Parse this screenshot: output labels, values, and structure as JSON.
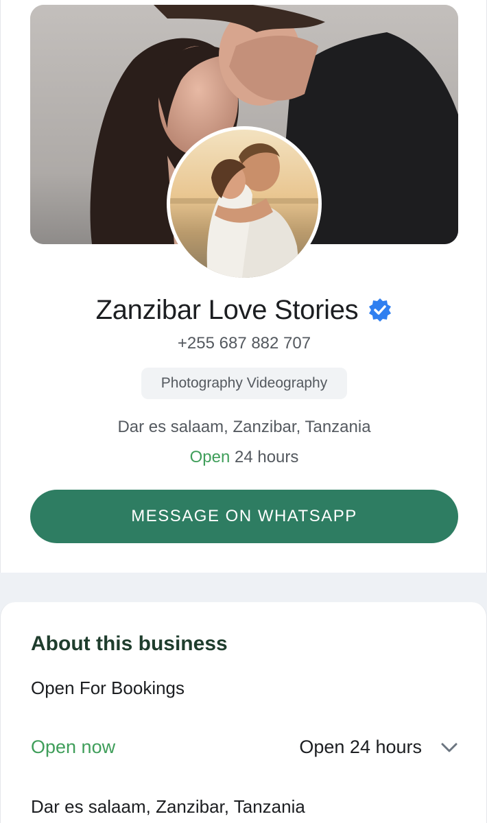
{
  "profile": {
    "name": "Zanzibar Love Stories",
    "phone": "+255 687 882 707",
    "category": "Photography Videography",
    "address": "Dar es salaam, Zanzibar, Tanzania",
    "hours_open_word": "Open",
    "hours_text": " 24 hours",
    "message_button": "MESSAGE ON WHATSAPP",
    "verified_icon": "verified-badge-icon"
  },
  "about": {
    "title": "About this business",
    "description": "Open For Bookings",
    "status": "Open now",
    "hours": "Open 24 hours",
    "address": "Dar es salaam, Zanzibar, Tanzania"
  },
  "colors": {
    "accent_green": "#2e7d62",
    "open_green": "#3f9e5a",
    "verified_blue": "#2f7ff0"
  }
}
